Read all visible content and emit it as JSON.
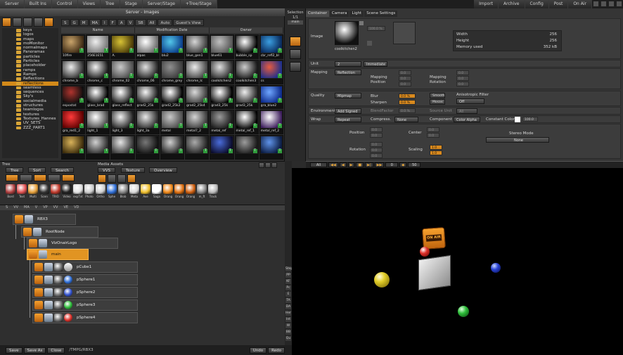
{
  "topmenu": {
    "left": [
      "Server",
      "Built Ins",
      "Control",
      "Views",
      "Tree",
      "Stage",
      "Server/Stage",
      "+Tree/Stage"
    ],
    "right": [
      "Import",
      "Archive",
      "Config",
      "Post",
      "On Air"
    ]
  },
  "images_panel": {
    "title": "Server - Images",
    "filters": [
      "S",
      "G",
      "M",
      "MA",
      "I",
      "F",
      "A",
      "V",
      "SB",
      "All",
      "Auto",
      "Guest's View"
    ],
    "columns": [
      "Name",
      "Modification Date",
      "Owner"
    ],
    "folders": [
      {
        "label": "keys"
      },
      {
        "label": "logos"
      },
      {
        "label": "maps"
      },
      {
        "label": "moMonitor"
      },
      {
        "label": "normalmaps"
      },
      {
        "label": "Panoramas"
      },
      {
        "label": "particles"
      },
      {
        "label": "Particles"
      },
      {
        "label": "placeholder"
      },
      {
        "label": "ramps"
      },
      {
        "label": "Ramps"
      },
      {
        "label": "Reflections"
      },
      {
        "label": "reflections",
        "selected": true
      },
      {
        "label": "seamless"
      },
      {
        "label": "sequences"
      },
      {
        "label": "Sky's"
      },
      {
        "label": "socialmedia"
      },
      {
        "label": "structures"
      },
      {
        "label": "teamlogos"
      },
      {
        "label": "textures"
      },
      {
        "label": "Textures_Hannes"
      },
      {
        "label": "UV_SETS"
      },
      {
        "label": "ZZZ_PART1"
      }
    ],
    "thumbs": [
      {
        "cap": "10fire",
        "c1": "#c9a46b",
        "c2": "#3d2a14"
      },
      {
        "cap": "256E1E51",
        "c1": "#eeeeee",
        "c2": "#777777"
      },
      {
        "cap": "A.",
        "c1": "#d7c235",
        "c2": "#4a3a08"
      },
      {
        "cap": "alpas",
        "c1": "#ffffff",
        "c2": "#6b6b6b"
      },
      {
        "cap": "blu2",
        "c1": "#53c7ea",
        "c2": "#0b3d8a"
      },
      {
        "cap": "blue_gen1",
        "c1": "#d6d6d6",
        "c2": "#3a3a3a"
      },
      {
        "cap": "blue61",
        "c1": "#bfbfbf",
        "c2": "#555555"
      },
      {
        "cap": "bubble_sp",
        "c1": "#ffffff",
        "c2": "#000000"
      },
      {
        "cap": "cbr_refl2_bl",
        "c1": "#3b9ee0",
        "c2": "#08285a"
      },
      {
        "cap": "chrome_b",
        "c1": "#ececec",
        "c2": "#2c2c2c"
      },
      {
        "cap": "chrome_c",
        "c1": "#f2f2f2",
        "c2": "#1a1a1a"
      },
      {
        "cap": "chrome_02",
        "c1": "#c9c9c9",
        "c2": "#4a4a4a"
      },
      {
        "cap": "chrome_06",
        "c1": "#e0e0e0",
        "c2": "#222222"
      },
      {
        "cap": "chrome_grey",
        "c1": "#8f8f8f",
        "c2": "#3a3a3a"
      },
      {
        "cap": "chrome_lc",
        "c1": "#ececec",
        "c2": "#444444"
      },
      {
        "cap": "coolkitchen2",
        "c1": "#dfdfdf",
        "c2": "#2a2a2a"
      },
      {
        "cap": "coolkitchen3",
        "c1": "#cccccc",
        "c2": "#1b1b1b"
      },
      {
        "cap": "cs",
        "c1": "#e65b3f",
        "c2": "#1d2f8c"
      },
      {
        "cap": "espostat",
        "c1": "#b0342e",
        "c2": "#0e0e0e"
      },
      {
        "cap": "glass_brad",
        "c1": "#ffffff",
        "c2": "#000000"
      },
      {
        "cap": "glass_reflect",
        "c1": "#ffffff",
        "c2": "#111111"
      },
      {
        "cap": "grad2_25k",
        "c1": "#f5f5f5",
        "c2": "#1a1a1a"
      },
      {
        "cap": "grad2_25k2",
        "c1": "#ffffff",
        "c2": "#000000"
      },
      {
        "cap": "grad2_25k4",
        "c1": "#d9d9d9",
        "c2": "#3a3a3a"
      },
      {
        "cap": "grad3_25k",
        "c1": "#ffffff",
        "c2": "#000000"
      },
      {
        "cap": "grad3_25k",
        "c1": "#eeeeee",
        "c2": "#2a2a2a"
      },
      {
        "cap": "gra_blue2",
        "c1": "#6fa6ff",
        "c2": "#0c2a8a"
      },
      {
        "cap": "gra_red1_2",
        "c1": "#ff3b3b",
        "c2": "#5a0000"
      },
      {
        "cap": "light_1",
        "c1": "#ffffff",
        "c2": "#444444"
      },
      {
        "cap": "light_3",
        "c1": "#f2f2f2",
        "c2": "#1e1e1e"
      },
      {
        "cap": "light_3a",
        "c1": "#e8e8e8",
        "c2": "#2a2a2a"
      },
      {
        "cap": "metal",
        "c1": "#c7c7c7",
        "c2": "#4b4b4b"
      },
      {
        "cap": "metal7_2",
        "c1": "#d4d4d4",
        "c2": "#3a3a3a"
      },
      {
        "cap": "metal_ref",
        "c1": "#9a9a9a",
        "c2": "#1a1a1a"
      },
      {
        "cap": "metal_ref_1",
        "c1": "#ffffff",
        "c2": "#000000"
      },
      {
        "cap": "metal_ref_2",
        "c1": "#ffffff",
        "c2": "#3a1a5a"
      },
      {
        "cap": "",
        "c1": "#d8b25a",
        "c2": "#3a2a0a"
      },
      {
        "cap": "",
        "c1": "#d0d0d0",
        "c2": "#2a2a2a"
      },
      {
        "cap": "",
        "c1": "#e5e5e5",
        "c2": "#333333"
      },
      {
        "cap": "",
        "c1": "#777777",
        "c2": "#111111"
      },
      {
        "cap": "",
        "c1": "#cfcfcf",
        "c2": "#202020"
      },
      {
        "cap": "",
        "c1": "#aaaaaa",
        "c2": "#222222"
      },
      {
        "cap": "",
        "c1": "#4a6cd9",
        "c2": "#0b0b2a"
      },
      {
        "cap": "",
        "c1": "#9c9c9c",
        "c2": "#1a1a1a"
      },
      {
        "cap": "",
        "c1": "#5f93e8",
        "c2": "#0a1a40"
      }
    ]
  },
  "tree_bar": {
    "tree_label": "Tree",
    "tree_buttons": [
      "Tree",
      "Sort",
      "Search"
    ],
    "media_label": "Media Assets",
    "media_buttons": [
      "VVS",
      "Texture",
      "Overview"
    ],
    "assets": [
      {
        "label": "Bord",
        "color": "#b04040"
      },
      {
        "label": "Text",
        "color": "#e05050"
      },
      {
        "label": "Multi",
        "color": "#e6a03a"
      },
      {
        "label": "Scen",
        "color": "#333333"
      },
      {
        "label": "TRIO",
        "color": "#c0392b"
      },
      {
        "label": "Video",
        "color": "#222222"
      },
      {
        "label": "expTxt",
        "color": "#e0e0e0"
      },
      {
        "label": "Photo",
        "color": "#cccccc"
      },
      {
        "label": "Ortho",
        "color": "#d0d0d0"
      },
      {
        "label": "Sphe",
        "color": "#2f6fd8"
      },
      {
        "label": "Blob",
        "color": "#888888"
      },
      {
        "label": "Meta",
        "color": "#d8d8d8"
      },
      {
        "label": "Ave",
        "color": "#f2c12e"
      },
      {
        "label": "Saga",
        "color": "#ffffff"
      },
      {
        "label": "Orang",
        "color": "#f28a1a"
      },
      {
        "label": "Orang",
        "color": "#e07010"
      },
      {
        "label": "Orang",
        "color": "#d06010"
      },
      {
        "label": "m_ft",
        "color": "#888888"
      },
      {
        "label": "Track",
        "color": "#bbbbbb"
      }
    ]
  },
  "scene_tree": {
    "header": [
      "S",
      "VV",
      "MA",
      "V",
      "VP",
      "VV",
      "VE",
      "VD"
    ],
    "nodes": [
      {
        "label": "RBX3"
      },
      {
        "label": "RootNode"
      },
      {
        "label": "VizOnairLogo"
      },
      {
        "label": "main",
        "selected": true
      },
      {
        "label": "pCube1"
      },
      {
        "label": "pSphere1",
        "sphere": "#2f6fd8"
      },
      {
        "label": "pSphere2",
        "sphere": "#3454d1"
      },
      {
        "label": "pSphere3",
        "sphere": "#2fbf3b"
      },
      {
        "label": "pSphere4",
        "sphere": "#e0322b"
      }
    ]
  },
  "bottom_bar": {
    "buttons": [
      "Save",
      "Save As",
      "Close"
    ],
    "path": "/TMPG/RBX3",
    "right_buttons": [
      "Undo",
      "Redo"
    ]
  },
  "side_strip": [
    "Step",
    "PP",
    "KF",
    "Pc",
    "E",
    "TA",
    "DA",
    "Her",
    "Int",
    "W",
    "BB",
    "Qu"
  ],
  "selection": {
    "label": "Selection",
    "count": "1/1",
    "mode": "main"
  },
  "properties": {
    "tabs": [
      "Container",
      "Camera",
      "Light",
      "Scene Settings"
    ],
    "image_label": "Image",
    "image_name": "coolkitchen2",
    "percent": "100.0 %",
    "info": {
      "width_k": "Width",
      "width_v": "256",
      "height_k": "Height",
      "height_v": "256",
      "mem_k": "Memory used",
      "mem_v": "352 kB"
    },
    "unit_label": "Unit",
    "unit_value": "2",
    "unit_button": "Immediate",
    "mapping_label": "Mapping",
    "mapping_value": "Reflection",
    "mapping_pos": "Mapping Position",
    "mapping_rot": "Mapping Rotation",
    "quality_label": "Quality",
    "quality_value": "Mipmap",
    "blur": "Blur",
    "sharpen": "Sharpen",
    "blur_value": "0.0 %",
    "sharpen_value": "0.0 %",
    "smooth": "Smooth",
    "mosaic": "Mosaic",
    "aniso_label": "Anisotropic Filter",
    "aniso_value": "Off",
    "env_label": "Environment",
    "env_value": "Add Signed",
    "blend": "BlendFactor",
    "blend_value": "0.0 %",
    "source_unit": "Source Unit",
    "source_value": "All",
    "wrap_label": "Wrap",
    "wrap_value": "Repeat",
    "compress": "Compress.",
    "compress_value": "None",
    "component": "Component",
    "component_value": "Color Alpha",
    "constant_color": "Constant Color",
    "constant_value": "100.0",
    "position": "Position",
    "center": "Center",
    "rotation": "Rotation",
    "scaling": "Scaling",
    "stereo_label": "Stereo Mode",
    "stereo_value": "None",
    "zero": "0.0",
    "one": "1.0"
  },
  "timeline": {
    "all": "All",
    "frame": "0",
    "fps": "50"
  },
  "viewport": {
    "logo_text": "ON AIR"
  },
  "colors": {
    "accent": "#e19422",
    "panel": "#353535",
    "viewport_bg": "#000000"
  }
}
